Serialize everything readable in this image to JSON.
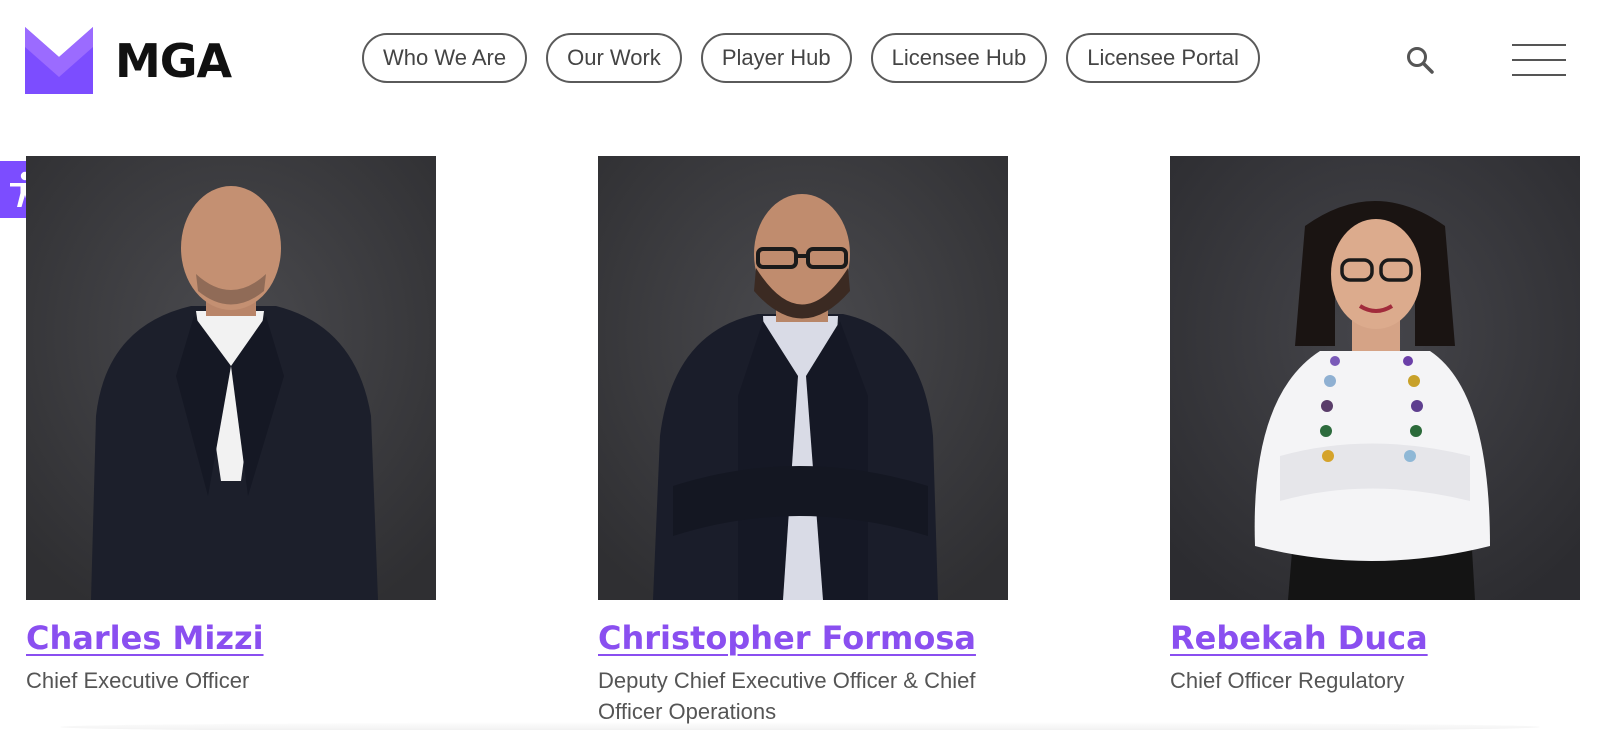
{
  "brand": {
    "name": "MGA",
    "accent": "#7c4dff",
    "link_color": "#8a4ff0"
  },
  "nav": {
    "items": [
      {
        "label": "Who We Are"
      },
      {
        "label": "Our Work"
      },
      {
        "label": "Player Hub"
      },
      {
        "label": "Licensee Hub"
      },
      {
        "label": "Licensee Portal"
      }
    ],
    "search_icon": "search-icon",
    "menu_icon": "hamburger-menu-icon"
  },
  "accessibility": {
    "icon": "accessibility-person-icon"
  },
  "team": [
    {
      "name": "Charles Mizzi",
      "role": "Chief Executive Officer"
    },
    {
      "name": "Christopher Formosa",
      "role": "Deputy Chief Executive Officer & Chief Officer Operations"
    },
    {
      "name": "Rebekah Duca",
      "role": "Chief Officer Regulatory"
    }
  ]
}
